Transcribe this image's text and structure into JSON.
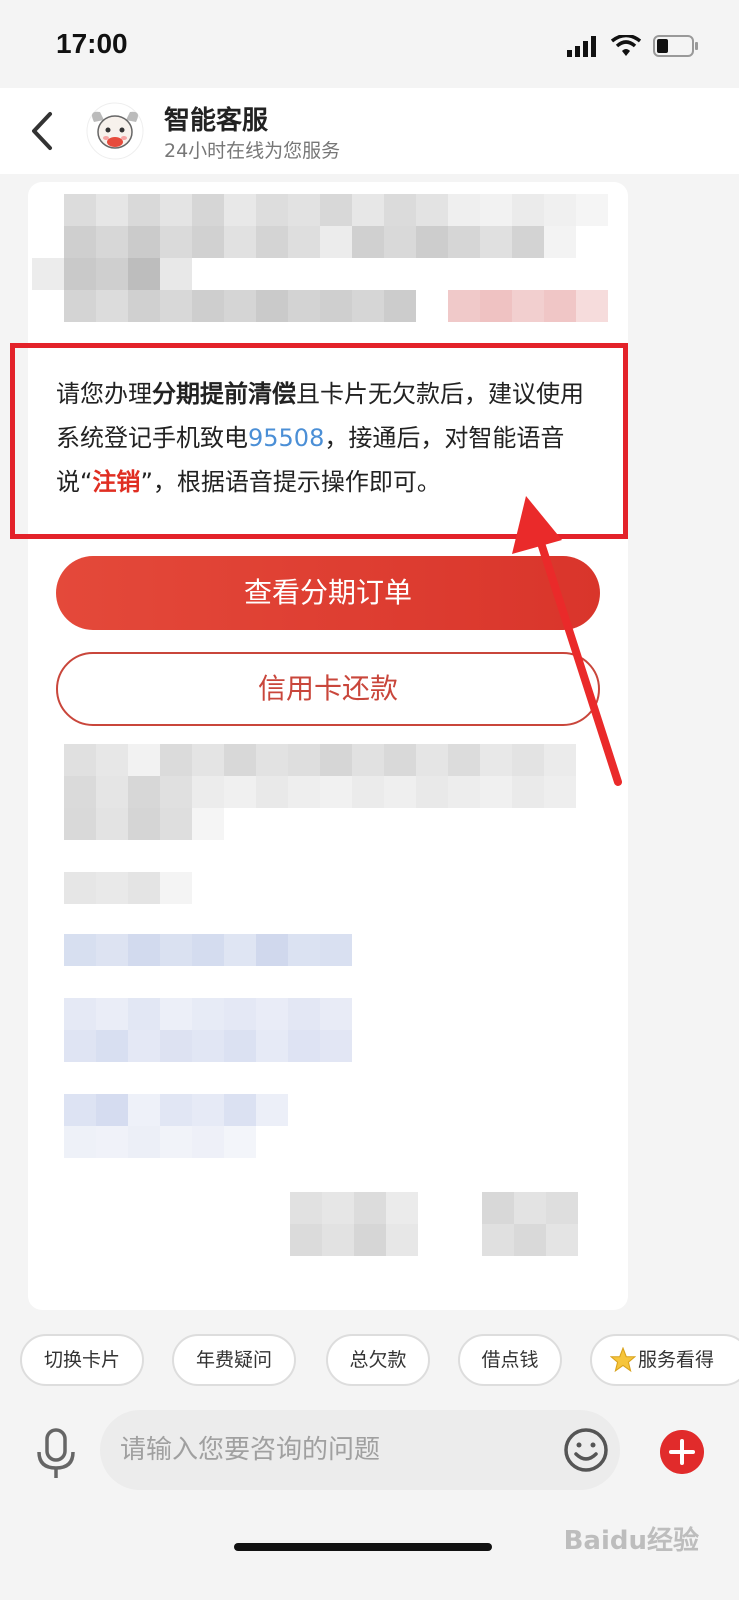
{
  "status_bar": {
    "time": "17:00"
  },
  "header": {
    "title": "智能客服",
    "subtitle": "24小时在线为您服务"
  },
  "message": {
    "part1": "请您办理",
    "bold": "分期提前清偿",
    "part2": "且卡片无欠款后，建议使用系统登记手机致电",
    "phone": "95508",
    "part3": "，接通后，对智能语音说“",
    "keyword": "注销",
    "part4": "”，根据语音提示操作即可。"
  },
  "buttons": {
    "primary": "查看分期订单",
    "secondary": "信用卡还款"
  },
  "chips": [
    "切换卡片",
    "年费疑问",
    "总欠款",
    "借点钱",
    "服务看得"
  ],
  "input": {
    "placeholder": "请输入您要咨询的问题"
  },
  "watermark": "Baidu经验",
  "colors": {
    "accent": "#e02e22",
    "link": "#4b8fd6",
    "highlight": "#e3222a"
  }
}
